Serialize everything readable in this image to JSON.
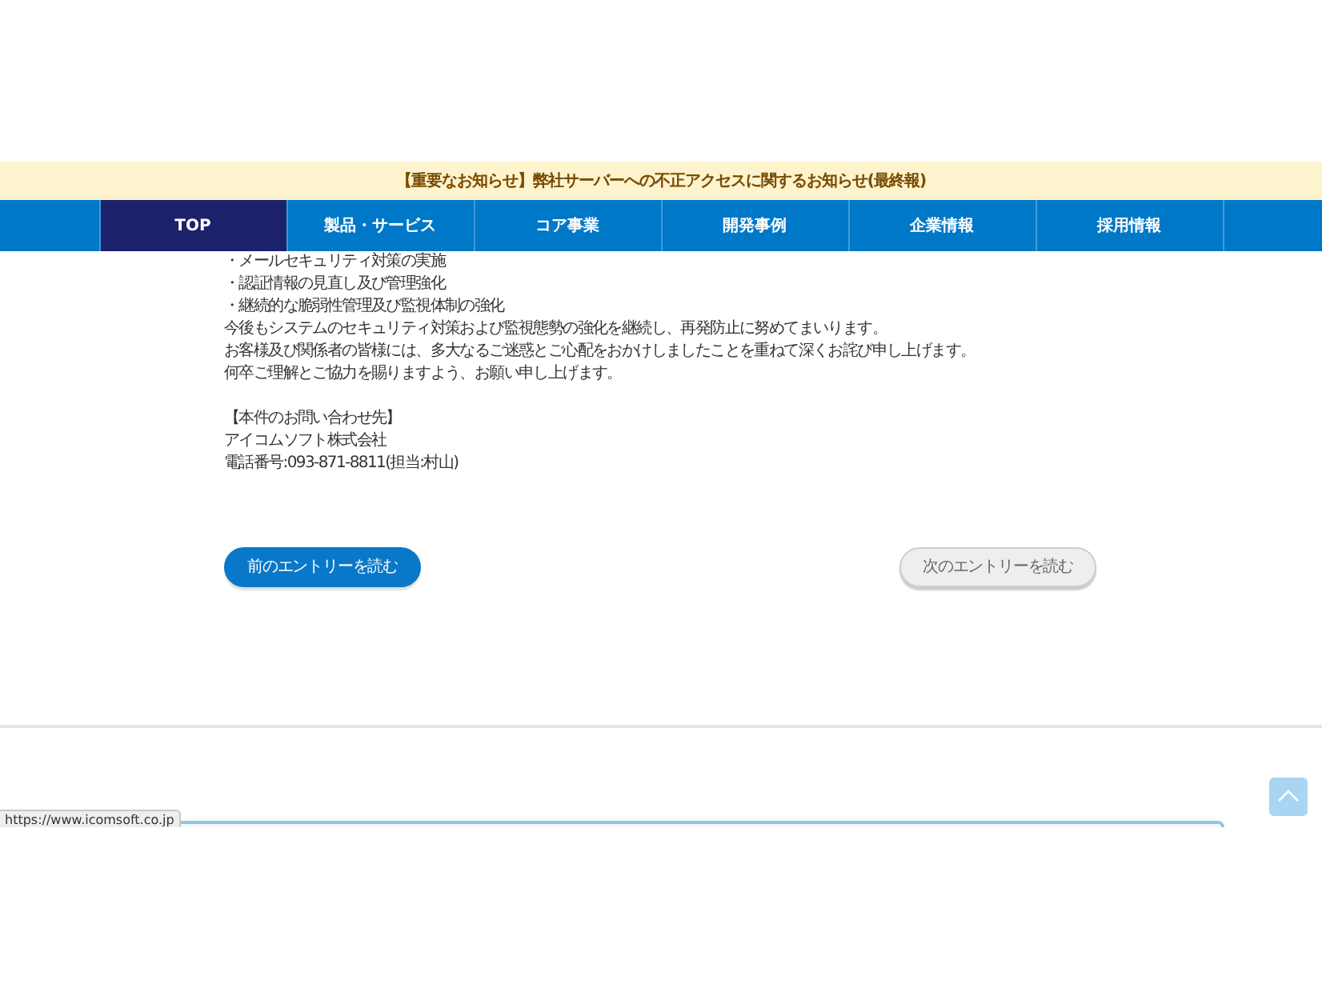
{
  "notice_bar": {
    "text": "【重要なお知らせ】弊社サーバーへの不正アクセスに関するお知らせ(最終報)"
  },
  "nav": [
    {
      "label": "TOP",
      "selected": true
    },
    {
      "label": "製品・サービス",
      "selected": false
    },
    {
      "label": "コア事業",
      "selected": false
    },
    {
      "label": "開発事例",
      "selected": false
    },
    {
      "label": "企業情報",
      "selected": false
    },
    {
      "label": "採用情報",
      "selected": false
    }
  ],
  "article": {
    "paragraphs": [
      [
        "・メールセキュリティ対策の実施",
        "・認証情報の見直し及び管理強化",
        "・継続的な脆弱性管理及び監視体制の強化",
        "今後もシステムのセキュリティ対策および監視態勢の強化を継続し、再発防止に努めてまいります。",
        "お客様及び関係者の皆様には、多大なるご迷惑とご心配をおかけしましたことを重ねて深くお詫び申し上げます。",
        "何卒ご理解とご協力を賜りますよう、お願い申し上げます。"
      ],
      [
        "【本件のお問い合わせ先】",
        "アイコムソフト株式会社",
        "電話番号:093-871-8811(担当:村山)"
      ]
    ]
  },
  "pager": [
    {
      "kind": "previous",
      "label": "前のエントリーを読む"
    },
    {
      "kind": "next",
      "label": "次のエントリーを読む"
    }
  ],
  "status_bar": {
    "url": "https://www.icomsoft.co.jp"
  }
}
